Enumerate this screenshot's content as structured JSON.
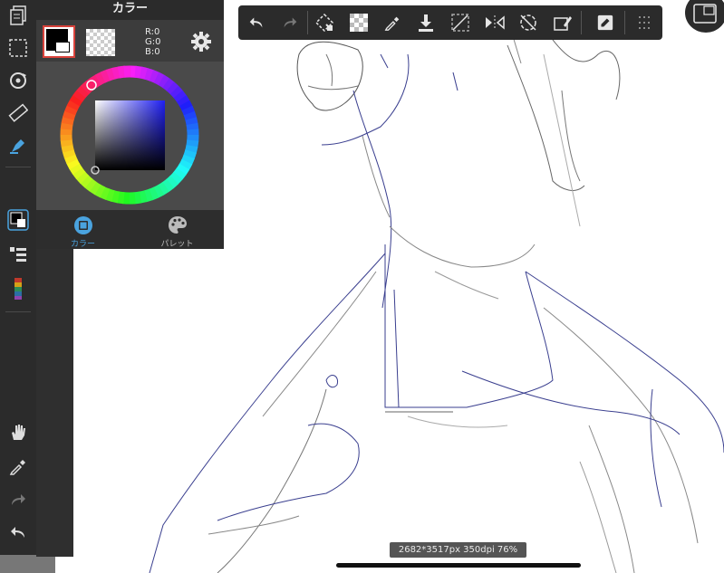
{
  "color_panel": {
    "title": "カラー",
    "rgb": {
      "r": "R:0",
      "g": "G:0",
      "b": "B:0"
    },
    "tabs": [
      {
        "label": "カラー",
        "active": true
      },
      {
        "label": "パレット",
        "active": false
      }
    ]
  },
  "status": {
    "text": "2682*3517px 350dpi 76%"
  },
  "colors": {
    "accent": "#4aa3df",
    "toolbar_bg": "#2b2b2b",
    "selected_swatch_border": "#d9423b",
    "stroke": "#3a3f8f"
  },
  "left_toolbar": {
    "icons": [
      "layers-icon",
      "selection-icon",
      "transform-icon",
      "ruler-icon",
      "brush-icon",
      "color-icon",
      "layer-list-icon",
      "color-bar-icon",
      "hand-icon",
      "eyedropper-icon",
      "redo-icon",
      "undo-icon"
    ]
  },
  "top_toolbar": {
    "icons": [
      "undo-icon",
      "redo-icon",
      "lasso-fill-icon",
      "transparent-icon",
      "eyedropper-icon",
      "download-icon",
      "deselect-icon",
      "flip-icon",
      "rotate-icon",
      "eraser-icon",
      "edit-icon",
      "grid-icon"
    ]
  }
}
